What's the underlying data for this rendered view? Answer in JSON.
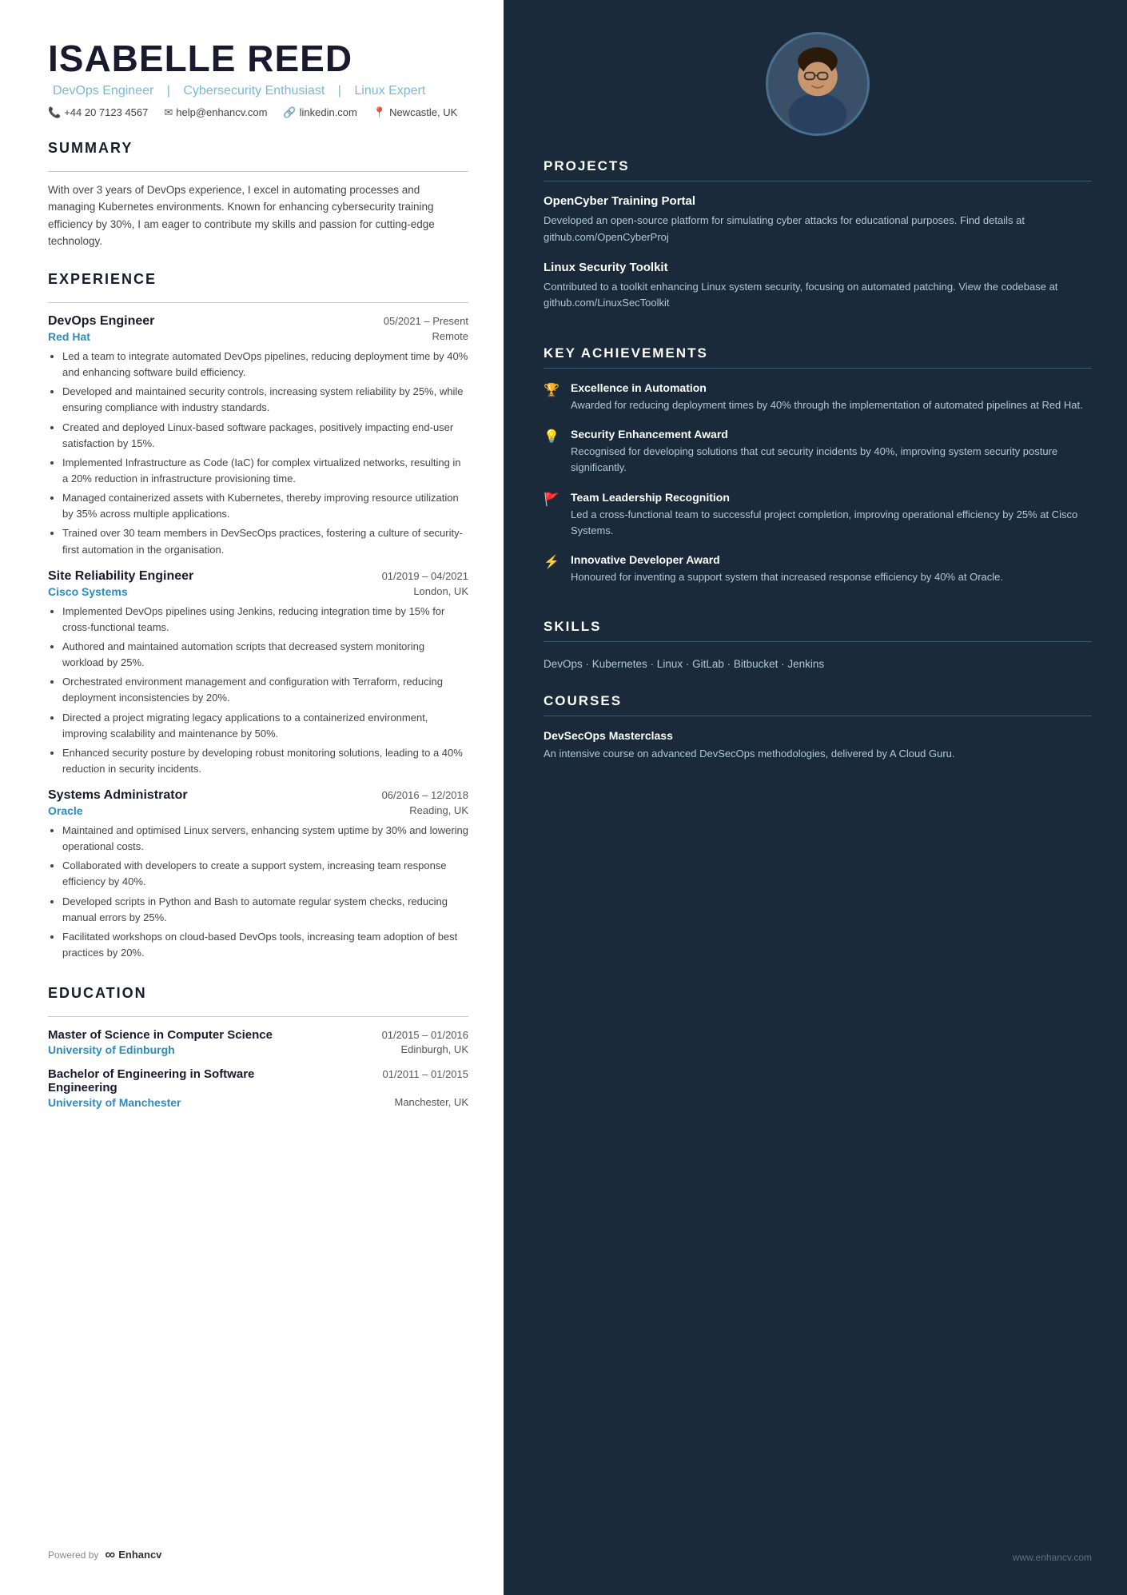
{
  "header": {
    "name": "ISABELLE REED",
    "tagline_parts": [
      "DevOps Engineer",
      "Cybersecurity Enthusiast",
      "Linux Expert"
    ],
    "phone": "+44 20 7123 4567",
    "email": "help@enhancv.com",
    "website": "linkedin.com",
    "location": "Newcastle, UK"
  },
  "summary": {
    "title": "SUMMARY",
    "text": "With over 3 years of DevOps experience, I excel in automating processes and managing Kubernetes environments. Known for enhancing cybersecurity training efficiency by 30%, I am eager to contribute my skills and passion for cutting-edge technology."
  },
  "experience": {
    "title": "EXPERIENCE",
    "jobs": [
      {
        "title": "DevOps Engineer",
        "date": "05/2021 – Present",
        "company": "Red Hat",
        "location": "Remote",
        "bullets": [
          "Led a team to integrate automated DevOps pipelines, reducing deployment time by 40% and enhancing software build efficiency.",
          "Developed and maintained security controls, increasing system reliability by 25%, while ensuring compliance with industry standards.",
          "Created and deployed Linux-based software packages, positively impacting end-user satisfaction by 15%.",
          "Implemented Infrastructure as Code (IaC) for complex virtualized networks, resulting in a 20% reduction in infrastructure provisioning time.",
          "Managed containerized assets with Kubernetes, thereby improving resource utilization by 35% across multiple applications.",
          "Trained over 30 team members in DevSecOps practices, fostering a culture of security-first automation in the organisation."
        ]
      },
      {
        "title": "Site Reliability Engineer",
        "date": "01/2019 – 04/2021",
        "company": "Cisco Systems",
        "location": "London, UK",
        "bullets": [
          "Implemented DevOps pipelines using Jenkins, reducing integration time by 15% for cross-functional teams.",
          "Authored and maintained automation scripts that decreased system monitoring workload by 25%.",
          "Orchestrated environment management and configuration with Terraform, reducing deployment inconsistencies by 20%.",
          "Directed a project migrating legacy applications to a containerized environment, improving scalability and maintenance by 50%.",
          "Enhanced security posture by developing robust monitoring solutions, leading to a 40% reduction in security incidents."
        ]
      },
      {
        "title": "Systems Administrator",
        "date": "06/2016 – 12/2018",
        "company": "Oracle",
        "location": "Reading, UK",
        "bullets": [
          "Maintained and optimised Linux servers, enhancing system uptime by 30% and lowering operational costs.",
          "Collaborated with developers to create a support system, increasing team response efficiency by 40%.",
          "Developed scripts in Python and Bash to automate regular system checks, reducing manual errors by 25%.",
          "Facilitated workshops on cloud-based DevOps tools, increasing team adoption of best practices by 20%."
        ]
      }
    ]
  },
  "education": {
    "title": "EDUCATION",
    "degrees": [
      {
        "degree": "Master of Science in Computer Science",
        "date": "01/2015 – 01/2016",
        "university": "University of Edinburgh",
        "location": "Edinburgh, UK"
      },
      {
        "degree": "Bachelor of Engineering in Software Engineering",
        "date": "01/2011 – 01/2015",
        "university": "University of Manchester",
        "location": "Manchester, UK"
      }
    ]
  },
  "footer_left": {
    "powered_by": "Powered by",
    "brand": "Enhancv"
  },
  "projects": {
    "title": "PROJECTS",
    "items": [
      {
        "title": "OpenCyber Training Portal",
        "desc": "Developed an open-source platform for simulating cyber attacks for educational purposes. Find details at github.com/OpenCyberProj"
      },
      {
        "title": "Linux Security Toolkit",
        "desc": "Contributed to a toolkit enhancing Linux system security, focusing on automated patching. View the codebase at github.com/LinuxSecToolkit"
      }
    ]
  },
  "achievements": {
    "title": "KEY ACHIEVEMENTS",
    "items": [
      {
        "icon": "🏆",
        "title": "Excellence in Automation",
        "desc": "Awarded for reducing deployment times by 40% through the implementation of automated pipelines at Red Hat."
      },
      {
        "icon": "💡",
        "title": "Security Enhancement Award",
        "desc": "Recognised for developing solutions that cut security incidents by 40%, improving system security posture significantly."
      },
      {
        "icon": "🚩",
        "title": "Team Leadership Recognition",
        "desc": "Led a cross-functional team to successful project completion, improving operational efficiency by 25% at Cisco Systems."
      },
      {
        "icon": "⚡",
        "title": "Innovative Developer Award",
        "desc": "Honoured for inventing a support system that increased response efficiency by 40% at Oracle."
      }
    ]
  },
  "skills": {
    "title": "SKILLS",
    "text": "DevOps · Kubernetes · Linux · GitLab · Bitbucket · Jenkins"
  },
  "courses": {
    "title": "COURSES",
    "items": [
      {
        "title": "DevSecOps Masterclass",
        "desc": "An intensive course on advanced DevSecOps methodologies, delivered by A Cloud Guru."
      }
    ]
  },
  "footer_right": {
    "website": "www.enhancv.com"
  }
}
